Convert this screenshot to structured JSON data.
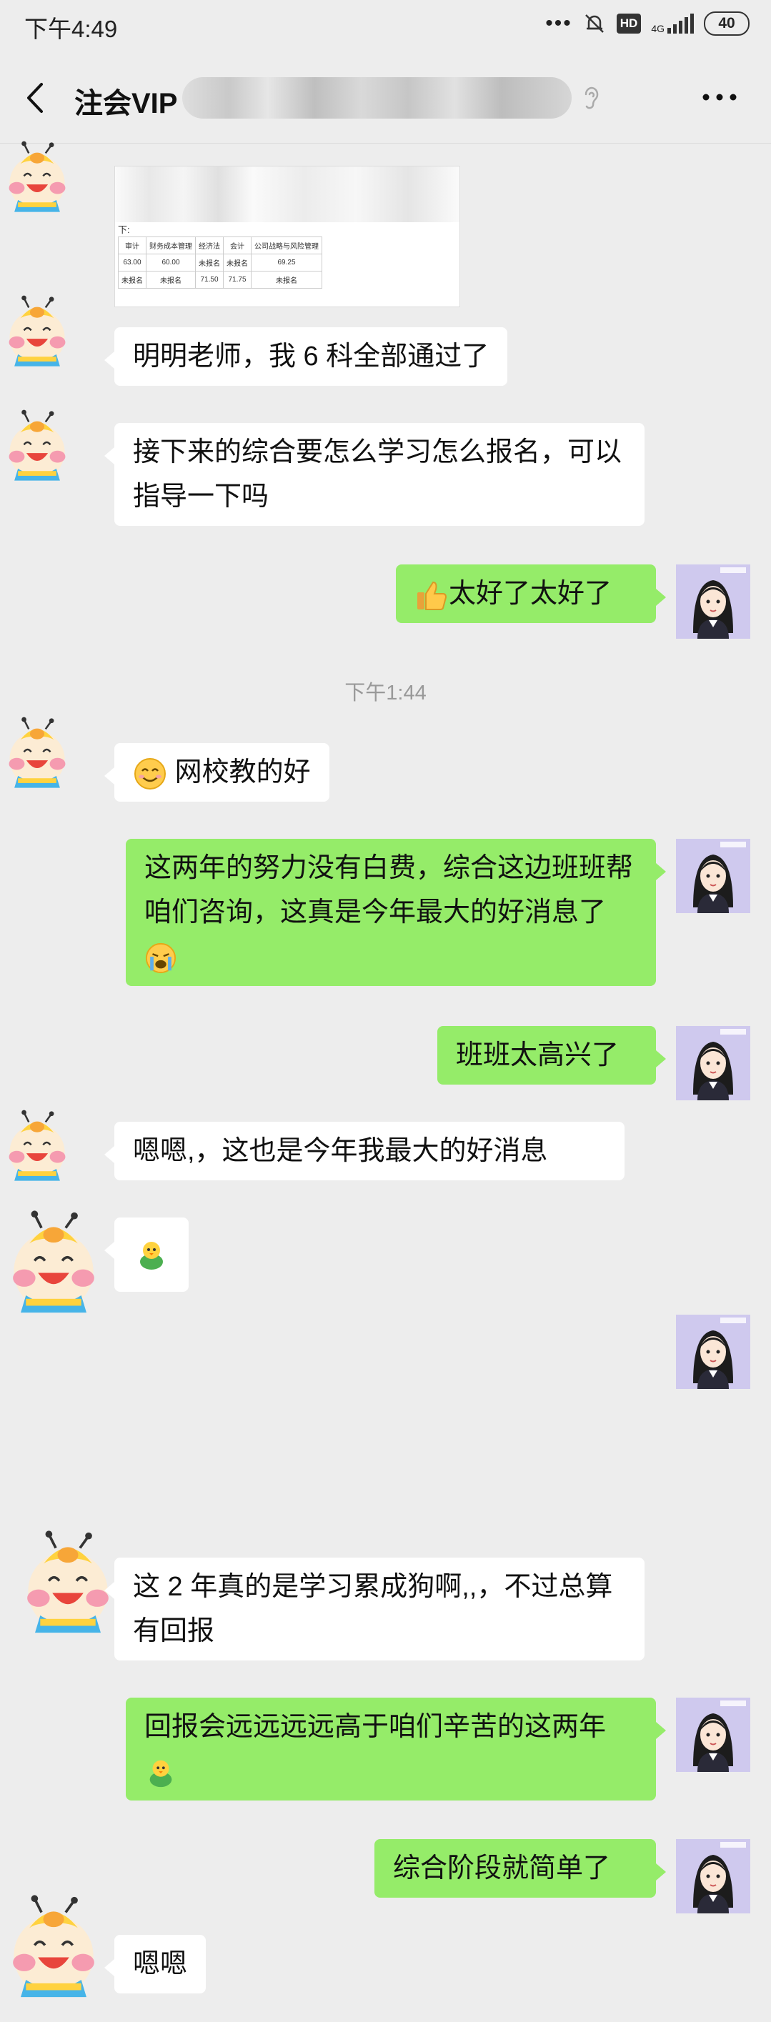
{
  "status_bar": {
    "time": "下午4:49",
    "more": "•••",
    "hd": "HD",
    "network": "4G",
    "battery": "40"
  },
  "header": {
    "title": "注会VIP"
  },
  "image_message": {
    "label": "下:",
    "headers": [
      "审计",
      "财务成本管理",
      "经济法",
      "会计",
      "公司战略与风险管理"
    ],
    "rows": [
      [
        "63.00",
        "60.00",
        "未报名",
        "未报名",
        "69.25"
      ],
      [
        "未报名",
        "未报名",
        "71.50",
        "71.75",
        "未报名"
      ]
    ]
  },
  "messages": [
    {
      "side": "left",
      "text": "明明老师，我 6 科全部通过了"
    },
    {
      "side": "left",
      "text": "接下来的综合要怎么学习怎么报名，可以指导一下吗"
    },
    {
      "side": "right",
      "text": "太好了太好了"
    },
    {
      "side": "left",
      "text": "网校教的好"
    },
    {
      "side": "right",
      "text": "这两年的努力没有白费，综合这边班班帮咱们咨询，这真是今年最大的好消息了"
    },
    {
      "side": "right",
      "text": "班班太高兴了"
    },
    {
      "side": "left",
      "text": "嗯嗯,，这也是今年我最大的好消息"
    },
    {
      "side": "left",
      "text": ""
    },
    {
      "side": "right",
      "text": ""
    },
    {
      "side": "left",
      "text": "这 2 年真的是学习累成狗啊,,，不过总算有回报"
    },
    {
      "side": "right",
      "text": "回报会远远远远高于咱们辛苦的这两年"
    },
    {
      "side": "right",
      "text": "综合阶段就简单了"
    },
    {
      "side": "left",
      "text": "嗯嗯"
    }
  ],
  "timestamp": "下午1:44",
  "icons": {
    "back": "back-arrow-icon",
    "ear": "ear-icon",
    "more": "more-icon",
    "thumbs_up": "thumbs-up-emoji",
    "smile": "smile-emoji",
    "cry": "crying-emoji",
    "chick": "chick-emoji"
  },
  "colors": {
    "background": "#ededed",
    "bubble_right": "#95ec69",
    "bubble_left": "#ffffff"
  }
}
